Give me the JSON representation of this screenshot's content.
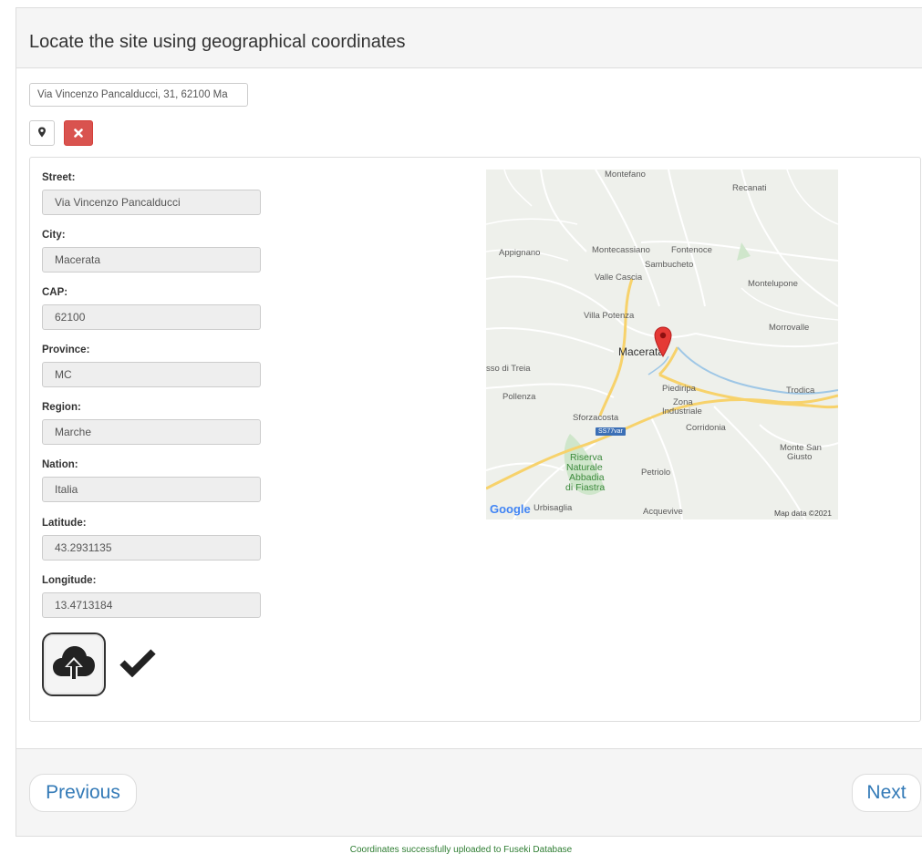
{
  "header": {
    "title": "Locate the site using geographical coordinates"
  },
  "search": {
    "address_value": "Via Vincenzo Pancalducci, 31, 62100 Ma"
  },
  "toolbar": {
    "locate_icon": "map-marker-icon",
    "clear_icon": "times-icon",
    "clear_color": "#d9534f"
  },
  "form": {
    "fields": [
      {
        "label": "Street:",
        "value": "Via Vincenzo Pancalducci"
      },
      {
        "label": "City:",
        "value": "Macerata"
      },
      {
        "label": "CAP:",
        "value": "62100"
      },
      {
        "label": "Province:",
        "value": "MC"
      },
      {
        "label": "Region:",
        "value": "Marche"
      },
      {
        "label": "Nation:",
        "value": "Italia"
      },
      {
        "label": "Latitude:",
        "value": "43.2931135"
      },
      {
        "label": "Longitude:",
        "value": "13.4713184"
      }
    ],
    "upload_icon": "cloud-upload-icon",
    "status_icon": "check-icon"
  },
  "map": {
    "places": {
      "montefano": "Montefano",
      "recanati": "Recanati",
      "appignano": "Appignano",
      "montecassiano": "Montecassiano",
      "fontenoce": "Fontenoce",
      "sambucheto": "Sambucheto",
      "valle_cascia": "Valle Cascia",
      "montelupone": "Montelupone",
      "villa_potenza": "Villa Potenza",
      "morrovalle": "Morrovalle",
      "macerata": "Macerata",
      "treia": "sso di Treia",
      "pollenza": "Pollenza",
      "piediripa": "Piediripa",
      "trodica": "Trodica",
      "zona": "Zona",
      "industriale": "Industriale",
      "sforzacosta": "Sforzacosta",
      "corridonia": "Corridonia",
      "monte_san": "Monte San",
      "giusto": "Giusto",
      "riserva": "Riserva",
      "naturale": "Naturale",
      "abbadia": "Abbadia",
      "fiastra": "di Fiastra",
      "petriolo": "Petriolo",
      "urbisaglia": "Urbisaglia",
      "acquevive": "Acquevive"
    },
    "road_badge": "SS77var",
    "google_logo": "Google",
    "attribution": "Map data ©2021",
    "marker_icon": "map-pin-icon",
    "marker_color": "#e53935"
  },
  "pager": {
    "previous_label": "Previous",
    "next_label": "Next"
  },
  "status": {
    "message": "Coordinates successfully uploaded to Fuseki Database",
    "color": "#2e7d32"
  }
}
